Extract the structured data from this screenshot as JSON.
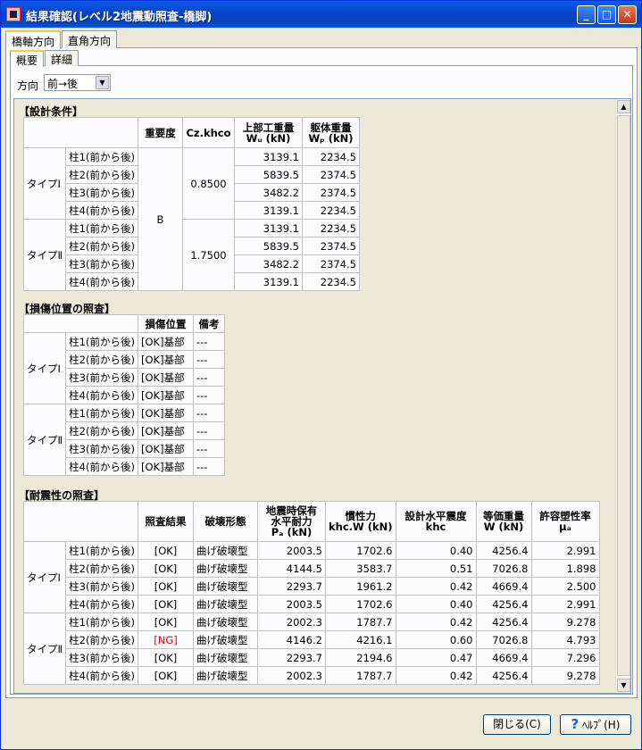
{
  "window": {
    "title": "結果確認(レベル2地震動照査-橋脚)"
  },
  "tabs_top": [
    "橋軸方向",
    "直角方向"
  ],
  "tabs_sub": [
    "概要",
    "詳細"
  ],
  "direction": {
    "label": "方向",
    "value": "前→後"
  },
  "design": {
    "title": "【設計条件】",
    "headers": [
      "重要度",
      "Cz.khco",
      "上部工重量",
      "Wᵤ (kN)",
      "躯体重量",
      "Wₚ (kN)"
    ],
    "type1": "タイプⅠ",
    "type2": "タイプⅡ",
    "importance": "B",
    "cz1": "0.8500",
    "cz2": "1.7500",
    "rows": [
      {
        "name": "柱1(前から後)",
        "wu": "3139.1",
        "wp": "2234.5"
      },
      {
        "name": "柱2(前から後)",
        "wu": "5839.5",
        "wp": "2374.5"
      },
      {
        "name": "柱3(前から後)",
        "wu": "3482.2",
        "wp": "2374.5"
      },
      {
        "name": "柱4(前から後)",
        "wu": "3139.1",
        "wp": "2234.5"
      },
      {
        "name": "柱1(前から後)",
        "wu": "3139.1",
        "wp": "2234.5"
      },
      {
        "name": "柱2(前から後)",
        "wu": "5839.5",
        "wp": "2374.5"
      },
      {
        "name": "柱3(前から後)",
        "wu": "3482.2",
        "wp": "2374.5"
      },
      {
        "name": "柱4(前から後)",
        "wu": "3139.1",
        "wp": "2234.5"
      }
    ]
  },
  "damage": {
    "title": "【損傷位置の照査】",
    "headers": [
      "損傷位置",
      "備考"
    ],
    "type1": "タイプⅠ",
    "type2": "タイプⅡ",
    "rows": [
      {
        "name": "柱1(前から後)",
        "pos": "[OK]基部",
        "note": "---"
      },
      {
        "name": "柱2(前から後)",
        "pos": "[OK]基部",
        "note": "---"
      },
      {
        "name": "柱3(前から後)",
        "pos": "[OK]基部",
        "note": "---"
      },
      {
        "name": "柱4(前から後)",
        "pos": "[OK]基部",
        "note": "---"
      },
      {
        "name": "柱1(前から後)",
        "pos": "[OK]基部",
        "note": "---"
      },
      {
        "name": "柱2(前から後)",
        "pos": "[OK]基部",
        "note": "---"
      },
      {
        "name": "柱3(前から後)",
        "pos": "[OK]基部",
        "note": "---"
      },
      {
        "name": "柱4(前から後)",
        "pos": "[OK]基部",
        "note": "---"
      }
    ]
  },
  "seismic": {
    "title": "【耐震性の照査】",
    "headers": [
      "照査結果",
      "破壊形態",
      "地震時保有",
      "水平耐力",
      "Pₐ (kN)",
      "慣性力",
      "khc.W (kN)",
      "設計水平震度",
      "khc",
      "等価重量",
      "W (kN)",
      "許容塑性率",
      "μₐ"
    ],
    "type1": "タイプⅠ",
    "type2": "タイプⅡ",
    "rows": [
      {
        "name": "柱1(前から後)",
        "res": "[OK]",
        "mode": "曲げ破壊型",
        "pa": "2003.5",
        "f": "1702.6",
        "khc": "0.40",
        "w": "4256.4",
        "mu": "2.991",
        "ng": false
      },
      {
        "name": "柱2(前から後)",
        "res": "[OK]",
        "mode": "曲げ破壊型",
        "pa": "4144.5",
        "f": "3583.7",
        "khc": "0.51",
        "w": "7026.8",
        "mu": "1.898",
        "ng": false
      },
      {
        "name": "柱3(前から後)",
        "res": "[OK]",
        "mode": "曲げ破壊型",
        "pa": "2293.7",
        "f": "1961.2",
        "khc": "0.42",
        "w": "4669.4",
        "mu": "2.500",
        "ng": false
      },
      {
        "name": "柱4(前から後)",
        "res": "[OK]",
        "mode": "曲げ破壊型",
        "pa": "2003.5",
        "f": "1702.6",
        "khc": "0.40",
        "w": "4256.4",
        "mu": "2.991",
        "ng": false
      },
      {
        "name": "柱1(前から後)",
        "res": "[OK]",
        "mode": "曲げ破壊型",
        "pa": "2002.3",
        "f": "1787.7",
        "khc": "0.42",
        "w": "4256.4",
        "mu": "9.278",
        "ng": false
      },
      {
        "name": "柱2(前から後)",
        "res": "[NG]",
        "mode": "曲げ破壊型",
        "pa": "4146.2",
        "f": "4216.1",
        "khc": "0.60",
        "w": "7026.8",
        "mu": "4.793",
        "ng": true
      },
      {
        "name": "柱3(前から後)",
        "res": "[OK]",
        "mode": "曲げ破壊型",
        "pa": "2293.7",
        "f": "2194.6",
        "khc": "0.47",
        "w": "4669.4",
        "mu": "7.296",
        "ng": false
      },
      {
        "name": "柱4(前から後)",
        "res": "[OK]",
        "mode": "曲げ破壊型",
        "pa": "2002.3",
        "f": "1787.7",
        "khc": "0.42",
        "w": "4256.4",
        "mu": "9.278",
        "ng": false
      }
    ]
  },
  "buttons": {
    "close": "閉じる(C)",
    "help_q": "?",
    "help": "ﾍﾙﾌﾟ(H)"
  },
  "titlebar_buttons": {
    "minimize": "_",
    "maximize": "□",
    "close": "✕"
  },
  "scroll": {
    "up": "▲",
    "down": "▼",
    "dropdown": "▼"
  },
  "colors": {
    "titlebar": "#0842c8",
    "ng": "#e00000",
    "tab_accent": "#ffc83c"
  }
}
